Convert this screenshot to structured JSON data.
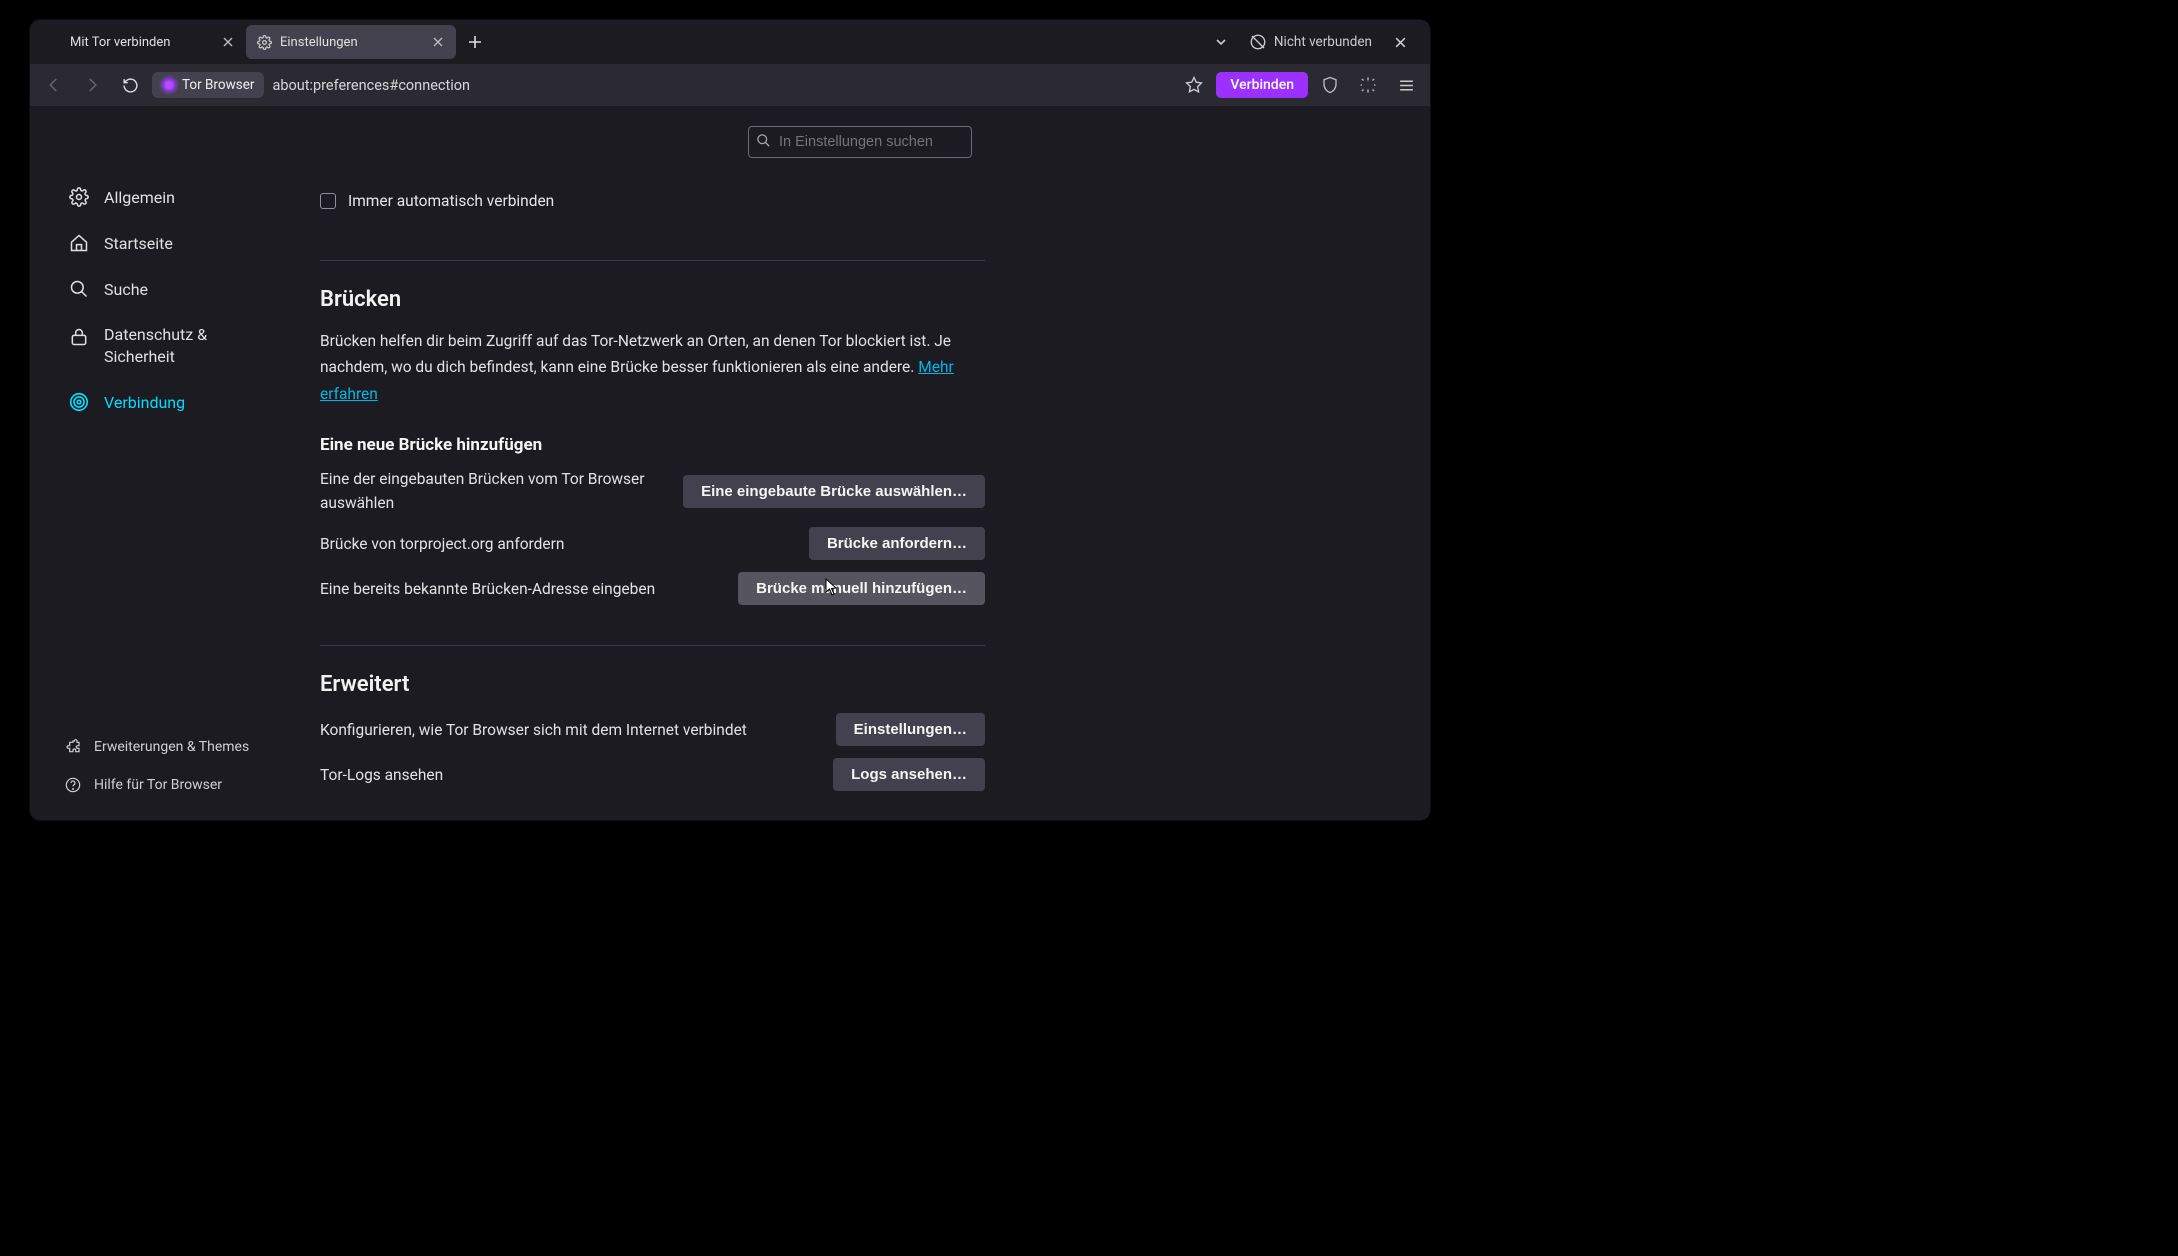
{
  "tabs": [
    {
      "label": "Mit Tor verbinden",
      "active": false
    },
    {
      "label": "Einstellungen",
      "active": true
    }
  ],
  "connection_status": "Nicht verbunden",
  "navbar": {
    "identity_label": "Tor Browser",
    "url": "about:preferences#connection",
    "connect_button": "Verbinden"
  },
  "search": {
    "placeholder": "In Einstellungen suchen"
  },
  "sidebar": {
    "items": [
      {
        "label": "Allgemein"
      },
      {
        "label": "Startseite"
      },
      {
        "label": "Suche"
      },
      {
        "label": "Datenschutz & Sicherheit"
      },
      {
        "label": "Verbindung"
      }
    ],
    "bottom": [
      {
        "label": "Erweiterungen & Themes"
      },
      {
        "label": "Hilfe für Tor Browser"
      }
    ]
  },
  "main": {
    "auto_connect": "Immer automatisch verbinden",
    "bridges": {
      "heading": "Brücken",
      "paragraph": "Brücken helfen dir beim Zugriff auf das Tor-Netzwerk an Orten, an denen Tor blockiert ist. Je nachdem, wo du dich befindest, kann eine Brücke besser funktionieren als eine andere.",
      "learn_more": "Mehr erfahren",
      "add_heading": "Eine neue Brücke hinzufügen",
      "rows": [
        {
          "desc": "Eine der eingebauten Brücken vom Tor Browser auswählen",
          "button": "Eine eingebaute Brücke auswählen…"
        },
        {
          "desc": "Brücke von torproject.org anfordern",
          "button": "Brücke anfordern…"
        },
        {
          "desc": "Eine bereits bekannte Brücken-Adresse eingeben",
          "button": "Brücke manuell hinzufügen…"
        }
      ]
    },
    "advanced": {
      "heading": "Erweitert",
      "rows": [
        {
          "desc": "Konfigurieren, wie Tor Browser sich mit dem Internet verbindet",
          "button": "Einstellungen…"
        },
        {
          "desc": "Tor-Logs ansehen",
          "button": "Logs ansehen…"
        }
      ]
    }
  }
}
